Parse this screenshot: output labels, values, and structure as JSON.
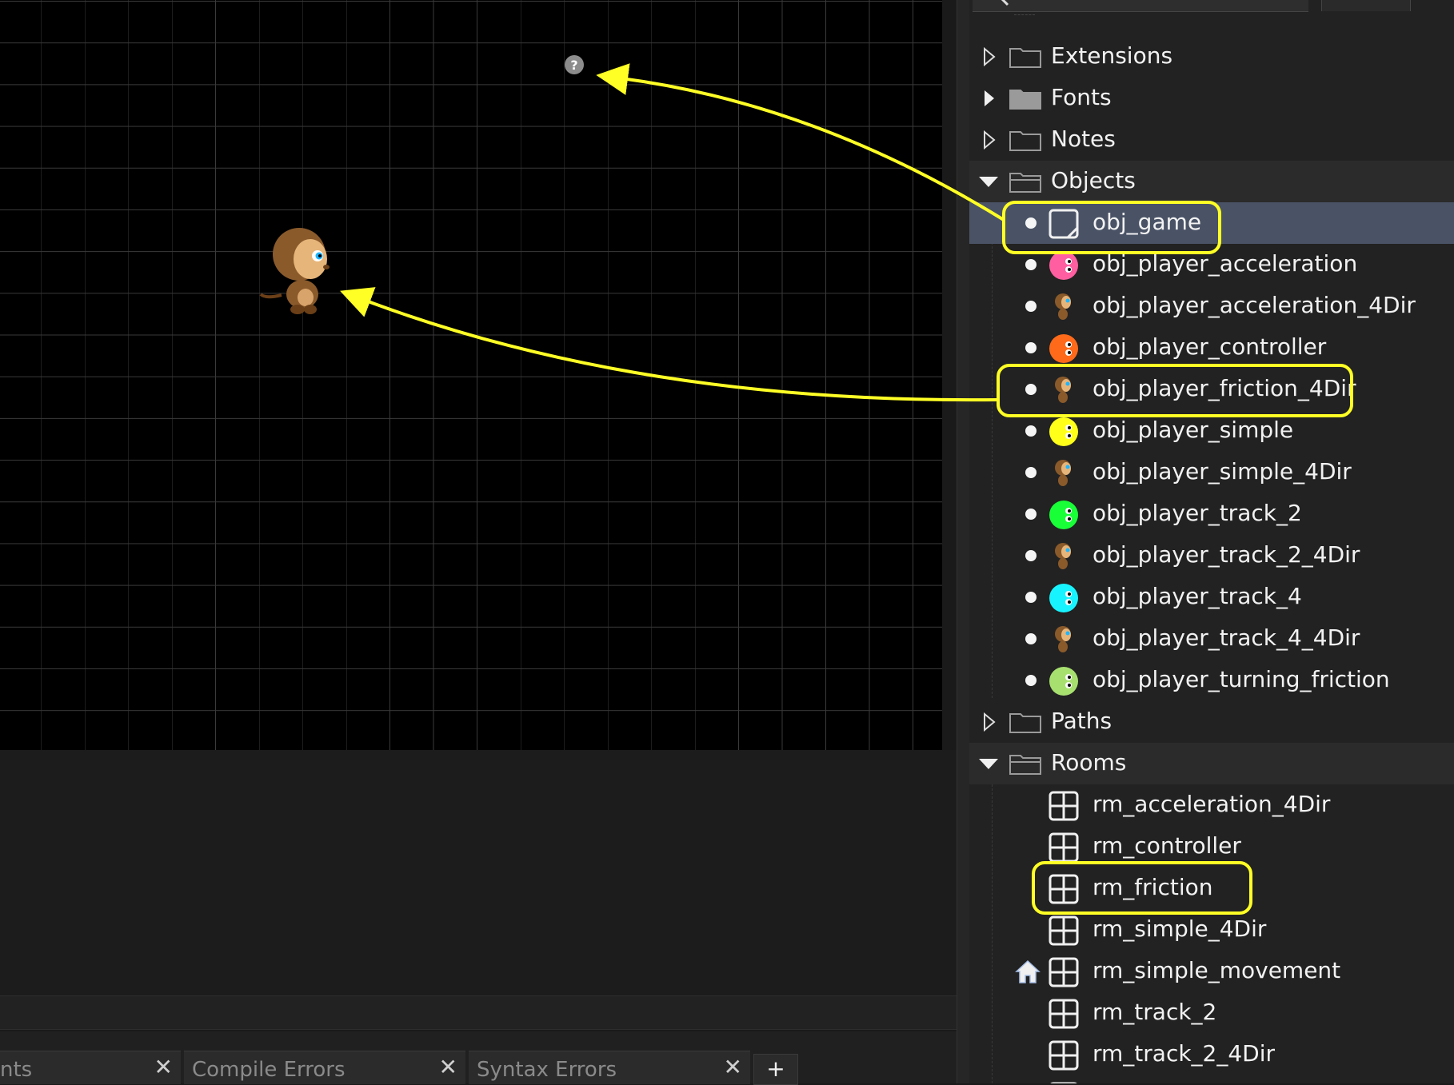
{
  "tree": {
    "folders": {
      "extensions": "Extensions",
      "fonts": "Fonts",
      "notes": "Notes",
      "objects": "Objects",
      "paths": "Paths",
      "rooms": "Rooms"
    },
    "objects": [
      {
        "label": "obj_game",
        "icon": "blank-object-icon",
        "color": "#ffffff"
      },
      {
        "label": "obj_player_acceleration",
        "icon": "pink-player-icon",
        "color": "#ff5fa0"
      },
      {
        "label": "obj_player_acceleration_4Dir",
        "icon": "monkey-icon",
        "color": "#8a5a2b"
      },
      {
        "label": "obj_player_controller",
        "icon": "orange-player-icon",
        "color": "#ff6a1a"
      },
      {
        "label": "obj_player_friction_4Dir",
        "icon": "monkey-icon",
        "color": "#8a5a2b"
      },
      {
        "label": "obj_player_simple",
        "icon": "yellow-player-icon",
        "color": "#ffff1a"
      },
      {
        "label": "obj_player_simple_4Dir",
        "icon": "monkey-icon",
        "color": "#8a5a2b"
      },
      {
        "label": "obj_player_track_2",
        "icon": "green-player-icon",
        "color": "#18ff38"
      },
      {
        "label": "obj_player_track_2_4Dir",
        "icon": "monkey-icon",
        "color": "#8a5a2b"
      },
      {
        "label": "obj_player_track_4",
        "icon": "cyan-player-icon",
        "color": "#18f4ff"
      },
      {
        "label": "obj_player_track_4_4Dir",
        "icon": "monkey-icon",
        "color": "#8a5a2b"
      },
      {
        "label": "obj_player_turning_friction",
        "icon": "lime-player-icon",
        "color": "#a8e070"
      }
    ],
    "rooms": [
      {
        "label": "rm_acceleration_4Dir"
      },
      {
        "label": "rm_controller"
      },
      {
        "label": "rm_friction"
      },
      {
        "label": "rm_simple_4Dir"
      },
      {
        "label": "rm_simple_movement",
        "home": true
      },
      {
        "label": "rm_track_2"
      },
      {
        "label": "rm_track_2_4Dir"
      }
    ]
  },
  "bottom_tabs": [
    {
      "label": "nts"
    },
    {
      "label": "Compile Errors"
    },
    {
      "label": "Syntax Errors"
    }
  ],
  "add_tab_label": "+",
  "colors": {
    "highlight": "#ffff26",
    "selected_row": "#4a5366",
    "canvas_bg": "#000000"
  }
}
